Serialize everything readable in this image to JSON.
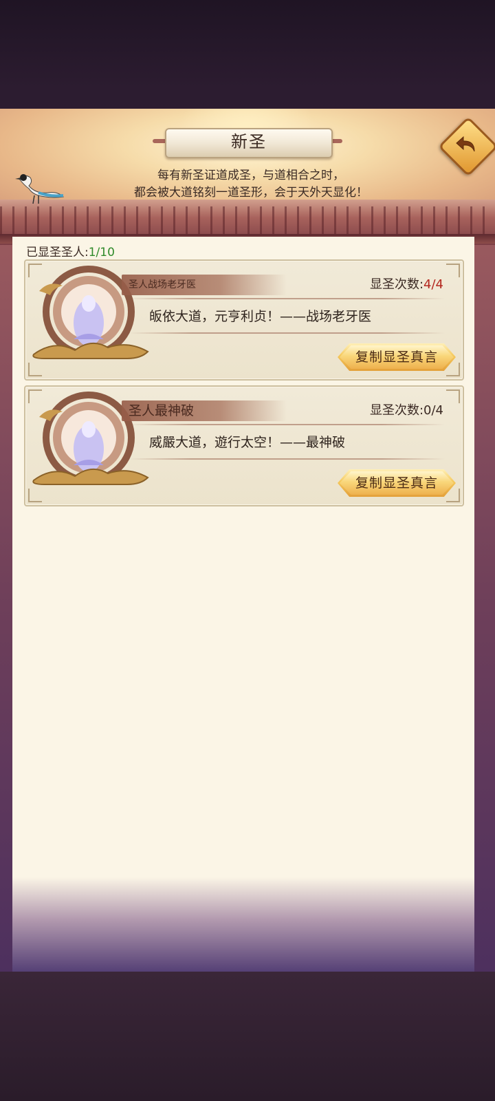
{
  "header": {
    "title": "新圣",
    "subtitle_line1": "每有新圣证道成圣，与道相合之时，",
    "subtitle_line2": "都会被大道铭刻一道圣形，会于天外天显化！"
  },
  "summary": {
    "label": "已显圣圣人:",
    "value": "1/10"
  },
  "cards": [
    {
      "name": "圣人战场老牙医",
      "count_label": "显圣次数:",
      "count_value": "4/4",
      "quote": "皈依大道，元亨利贞！——战场老牙医",
      "button": "复制显圣真言"
    },
    {
      "name": "圣人最神破",
      "count_label": "显圣次数:",
      "count_value": "0/4",
      "quote": "威嚴大道，遊行太空！——最神破",
      "button": "复制显圣真言"
    }
  ],
  "colors": {
    "count_highlight": "#b3261e",
    "summary_value": "#2f8a2a",
    "button_gold": "#f5c85c"
  }
}
